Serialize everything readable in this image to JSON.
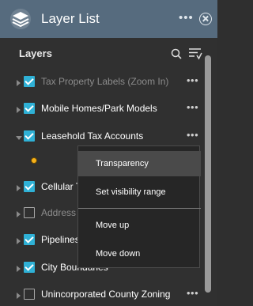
{
  "window": {
    "title": "Layer List",
    "more_label": "•••"
  },
  "layers_panel": {
    "header": "Layers",
    "items": [
      {
        "label": "Tax Property Labels (Zoom In)",
        "checked": true,
        "dimmed": true,
        "expanded": false,
        "more": "•••"
      },
      {
        "label": "Mobile Homes/Park Models",
        "checked": true,
        "dimmed": false,
        "expanded": false,
        "more": "•••"
      },
      {
        "label": "Leasehold Tax Accounts",
        "checked": true,
        "dimmed": false,
        "expanded": true,
        "more": "•••"
      },
      {
        "label": "Cellular Ta",
        "checked": true,
        "dimmed": false,
        "expanded": false,
        "more": ""
      },
      {
        "label": "Address P",
        "checked": false,
        "dimmed": true,
        "expanded": false,
        "more": ""
      },
      {
        "label": "Pipelines",
        "checked": true,
        "dimmed": false,
        "expanded": false,
        "more": ""
      },
      {
        "label": "City Boundaries",
        "checked": true,
        "dimmed": false,
        "expanded": false,
        "more": ""
      },
      {
        "label": "Unincorporated County Zoning",
        "checked": false,
        "dimmed": false,
        "expanded": false,
        "more": "•••"
      }
    ]
  },
  "context_menu": {
    "items": [
      "Transparency",
      "Set visibility range",
      "Move up",
      "Move down"
    ]
  },
  "colors": {
    "titlebar": "#566b7e",
    "panel": "#303030",
    "checkbox": "#2fb1d6",
    "legend_point": "#f6b11a"
  },
  "icons": {
    "title": "layers-stack-icon",
    "search": "search-icon",
    "sort": "sort-list-icon",
    "close": "close-circle-icon"
  }
}
